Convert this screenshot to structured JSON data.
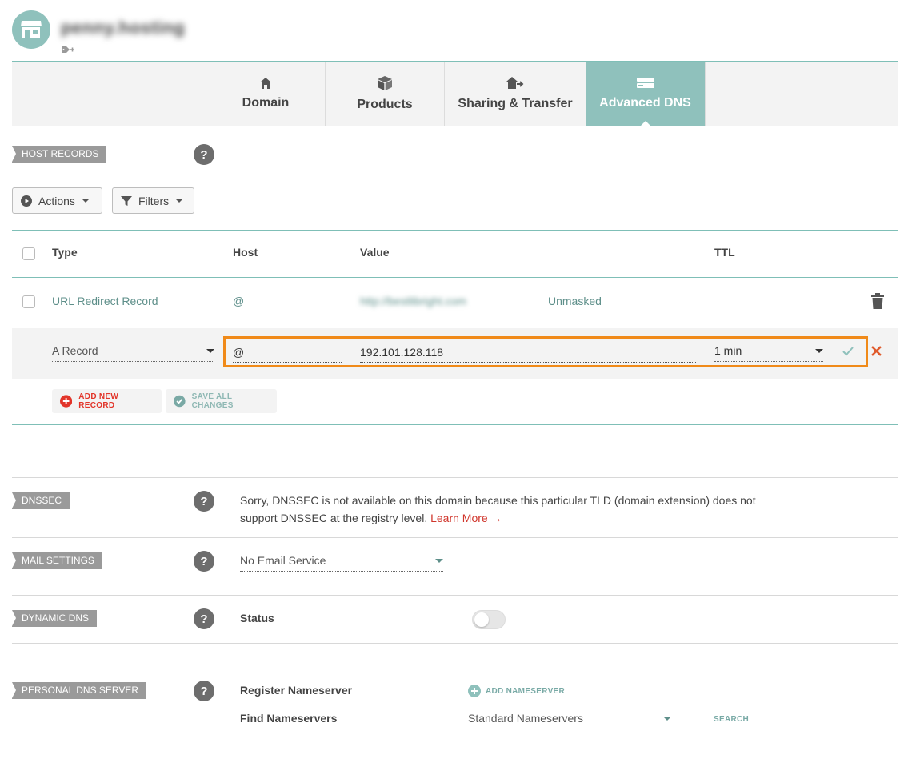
{
  "header": {
    "domain_name": "penny.hosting",
    "avatar_icon": "store-icon",
    "tag_icon": "add-tag-icon"
  },
  "tabs": [
    {
      "label": "Domain",
      "icon": "home-icon",
      "active": false
    },
    {
      "label": "Products",
      "icon": "box-icon",
      "active": false
    },
    {
      "label": "Sharing & Transfer",
      "icon": "share-home-icon",
      "active": false
    },
    {
      "label": "Advanced DNS",
      "icon": "server-icon",
      "active": true
    }
  ],
  "host_records": {
    "label": "HOST RECORDS",
    "help": "?",
    "actions_label": "Actions",
    "filters_label": "Filters",
    "columns": {
      "type": "Type",
      "host": "Host",
      "value": "Value",
      "ttl": "TTL"
    },
    "rows": [
      {
        "type": "URL Redirect Record",
        "host": "@",
        "value": "http://bestlibright.com",
        "extra": "Unmasked"
      }
    ],
    "editing": {
      "type": "A Record",
      "host": "@",
      "value": "192.101.128.118",
      "ttl": "1 min"
    },
    "add_new_record": "ADD NEW RECORD",
    "save_all_changes": "SAVE ALL CHANGES"
  },
  "dnssec": {
    "label": "DNSSEC",
    "help": "?",
    "text": "Sorry, DNSSEC is not available on this domain because this particular TLD (domain extension) does not support DNSSEC at the registry level.",
    "learn_more": "Learn More →"
  },
  "mail_settings": {
    "label": "MAIL SETTINGS",
    "help": "?",
    "selected": "No Email Service"
  },
  "dynamic_dns": {
    "label": "DYNAMIC DNS",
    "help": "?",
    "status_label": "Status",
    "enabled": false
  },
  "personal_dns": {
    "label": "PERSONAL DNS SERVER",
    "help": "?",
    "register_label": "Register Nameserver",
    "add_nameserver": "ADD NAMESERVER",
    "find_label": "Find Nameservers",
    "find_selected": "Standard Nameservers",
    "search_label": "SEARCH"
  },
  "colors": {
    "accent": "#8fc1bc",
    "highlight": "#f08a19",
    "danger": "#e05a2b",
    "add_red": "#e2352a"
  }
}
